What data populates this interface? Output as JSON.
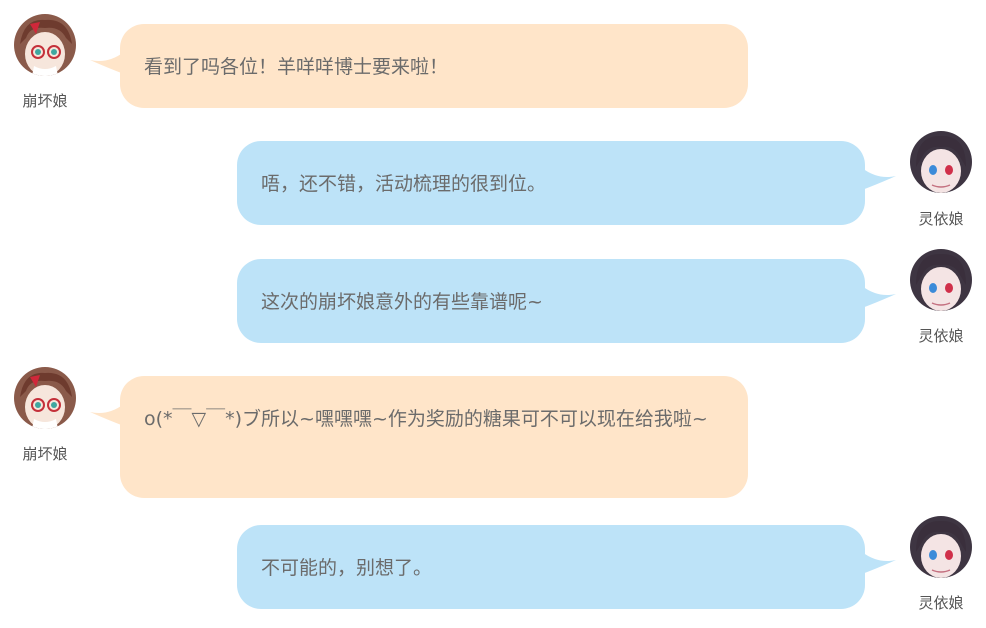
{
  "colors": {
    "left_bubble": "#ffe5c9",
    "right_bubble": "#bde3f8",
    "text": "#6b6b6b",
    "name_text": "#555555"
  },
  "messages": [
    {
      "side": "left",
      "speaker": "崩坏娘",
      "avatar": "bengbu-girl-avatar",
      "text": "看到了吗各位！羊咩咩博士要来啦！"
    },
    {
      "side": "right",
      "speaker": "灵依娘",
      "avatar": "lingyi-girl-avatar",
      "text": "唔，还不错，活动梳理的很到位。"
    },
    {
      "side": "right",
      "speaker": "灵依娘",
      "avatar": "lingyi-girl-avatar",
      "text": "这次的崩坏娘意外的有些靠谱呢~"
    },
    {
      "side": "left",
      "speaker": "崩坏娘",
      "avatar": "bengbu-girl-avatar",
      "text": "o(*￣▽￣*)ブ所以~嘿嘿嘿~作为奖励的糖果可不可以现在给我啦~"
    },
    {
      "side": "right",
      "speaker": "灵依娘",
      "avatar": "lingyi-girl-avatar",
      "text": "不可能的，别想了。"
    }
  ]
}
